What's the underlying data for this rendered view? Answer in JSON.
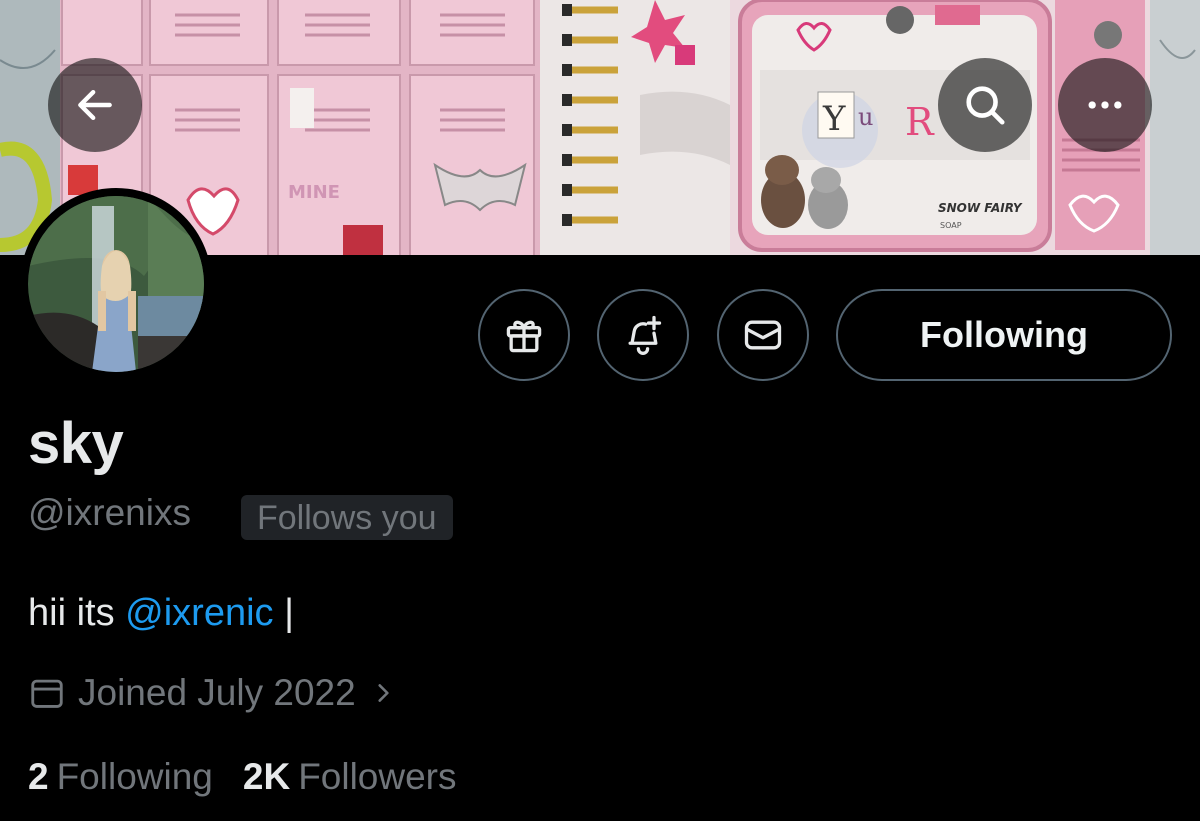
{
  "banner": {
    "back_icon": "arrow-left-icon",
    "search_icon": "search-icon",
    "more_icon": "more-horizontal-icon",
    "sticker_texts": [
      "MINE",
      "YOUR",
      "SNOW FAIRY",
      "SOAP"
    ],
    "colors": {
      "locker_pink": "#e8b8c8",
      "tv_pink": "#e9a8bd",
      "paper": "#ece6e4"
    }
  },
  "actions": {
    "gift_icon": "gift-icon",
    "notify_icon": "bell-plus-icon",
    "message_icon": "envelope-icon",
    "following_label": "Following"
  },
  "profile": {
    "display_name": "sky",
    "handle": "@ixrenixs",
    "follows_you": "Follows you",
    "bio_text": "hii its ",
    "bio_mention": "@ixrenic",
    "bio_suffix": " |",
    "joined": "Joined July 2022"
  },
  "stats": {
    "following_count": "2",
    "following_label": "Following",
    "followers_count": "2K",
    "followers_label": "Followers"
  },
  "colors": {
    "background": "#000000",
    "text_primary": "#e7e9ea",
    "text_secondary": "#71767b",
    "link": "#1d9bf0",
    "border": "#536471"
  }
}
